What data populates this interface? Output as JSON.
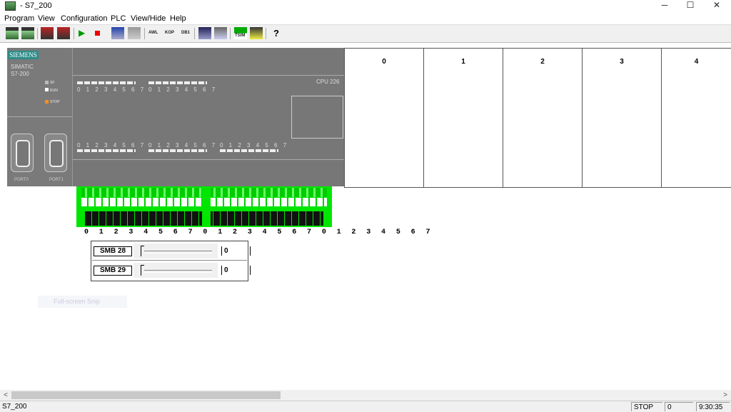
{
  "window": {
    "title": "- S7_200",
    "min": "─",
    "max": "☐",
    "close": "✕"
  },
  "menu": [
    "Program",
    "View",
    "Configuration",
    "PLC",
    "View/Hide",
    "Help"
  ],
  "toolbar": {
    "awl": "AWL",
    "kop": "KOP",
    "db1": "DB1",
    "tsim": "TSIM",
    "help": "?"
  },
  "plc": {
    "brand": "SIEMENS",
    "family": "SIMATIC",
    "model": "S7-200",
    "cpu": "CPU 226",
    "leds": [
      "SF",
      "RUN",
      "STOP"
    ],
    "io_labels": "0 1 2 3 4 5 6 7",
    "ports": [
      "PORT0",
      "PORT1"
    ]
  },
  "slots": [
    "0",
    "1",
    "2",
    "3",
    "4"
  ],
  "terminal_digits": "0 1 2 3 4 5 6 7 0 1 2 3 4  5 6 7 0 1 2 3 4 5 6 7",
  "smb": [
    {
      "label": "SMB 28",
      "value": "0"
    },
    {
      "label": "SMB 29",
      "value": "0"
    }
  ],
  "ghost_text": "Full-screen Snip",
  "scroll": {
    "left": "<",
    "right": ">"
  },
  "status": {
    "name": "S7_200",
    "mode": "STOP",
    "value": "0",
    "time": "9:30:35"
  },
  "colors": {
    "terminal": "#00e600",
    "siemens": "#2e8c89",
    "stop_led": "#ff8c1a"
  }
}
